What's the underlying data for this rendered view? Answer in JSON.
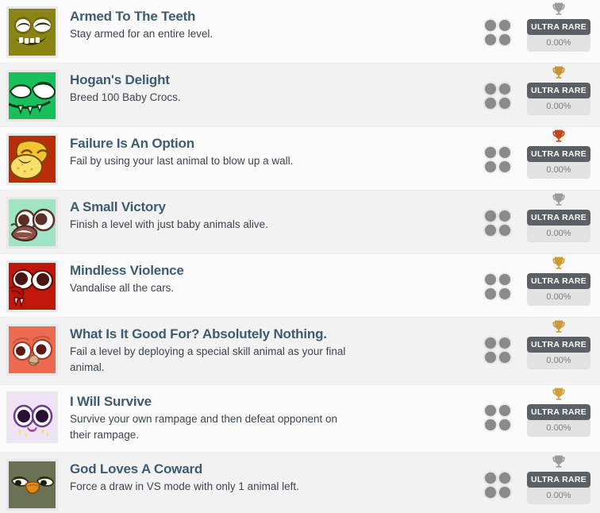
{
  "list": {
    "name": "achievement-list",
    "rarity_label": "ULTRA RARE",
    "items": [
      {
        "title": "Armed To The Teeth",
        "description": "Stay armed for an entire level.",
        "rarity": "ULTRA RARE",
        "percent": "0.00%",
        "trophy": "trophy-icon",
        "trophy_color": "#9a9a9a",
        "icon_name": "avatar-armed-to-the-teeth",
        "icon_bg": "#8a8414",
        "row_bg": "#fafafa"
      },
      {
        "title": "Hogan's Delight",
        "description": "Breed 100 Baby Crocs.",
        "rarity": "ULTRA RARE",
        "percent": "0.00%",
        "trophy": "trophy-icon",
        "trophy_color": "#c69434",
        "icon_name": "avatar-hogans-delight",
        "icon_bg": "#17c05b",
        "row_bg": "#f2f2f2"
      },
      {
        "title": "Failure Is An Option",
        "description": "Fail by using your last animal to blow up a wall.",
        "rarity": "ULTRA RARE",
        "percent": "0.00%",
        "trophy": "trophy-icon",
        "trophy_color": "#c2491d",
        "icon_name": "avatar-failure-is-an-option",
        "icon_bg": "#b92d08",
        "row_bg": "#fafafa"
      },
      {
        "title": "A Small Victory",
        "description": "Finish a level with just baby animals alive.",
        "rarity": "ULTRA RARE",
        "percent": "0.00%",
        "trophy": "trophy-icon",
        "trophy_color": "#9a9a9a",
        "icon_name": "avatar-a-small-victory",
        "icon_bg": "#9fe4c4",
        "row_bg": "#f2f2f2"
      },
      {
        "title": "Mindless Violence",
        "description": "Vandalise all the cars.",
        "rarity": "ULTRA RARE",
        "percent": "0.00%",
        "trophy": "trophy-icon",
        "trophy_color": "#d09a31",
        "icon_name": "avatar-mindless-violence",
        "icon_bg": "#c0170d",
        "row_bg": "#fafafa"
      },
      {
        "title": "What Is It Good For? Absolutely Nothing.",
        "description": "Fail a level by deploying a special skill animal as your final animal.",
        "rarity": "ULTRA RARE",
        "percent": "0.00%",
        "trophy": "trophy-icon",
        "trophy_color": "#c99a3a",
        "icon_name": "avatar-what-is-it-good-for",
        "icon_bg": "#ec6a52",
        "row_bg": "#f2f2f2"
      },
      {
        "title": "I Will Survive",
        "description": "Survive your own rampage and then defeat opponent on their rampage.",
        "rarity": "ULTRA RARE",
        "percent": "0.00%",
        "trophy": "trophy-icon",
        "trophy_color": "#d2a03a",
        "icon_name": "avatar-i-will-survive",
        "icon_bg": "#f0e2f7",
        "row_bg": "#fafafa"
      },
      {
        "title": "God Loves A Coward",
        "description": "Force a draw in VS mode with only 1 animal left.",
        "rarity": "ULTRA RARE",
        "percent": "0.00%",
        "trophy": "trophy-icon",
        "trophy_color": "#9a9a9a",
        "icon_name": "avatar-god-loves-a-coward",
        "icon_bg": "#6b7253",
        "row_bg": "#f2f2f2"
      }
    ]
  }
}
